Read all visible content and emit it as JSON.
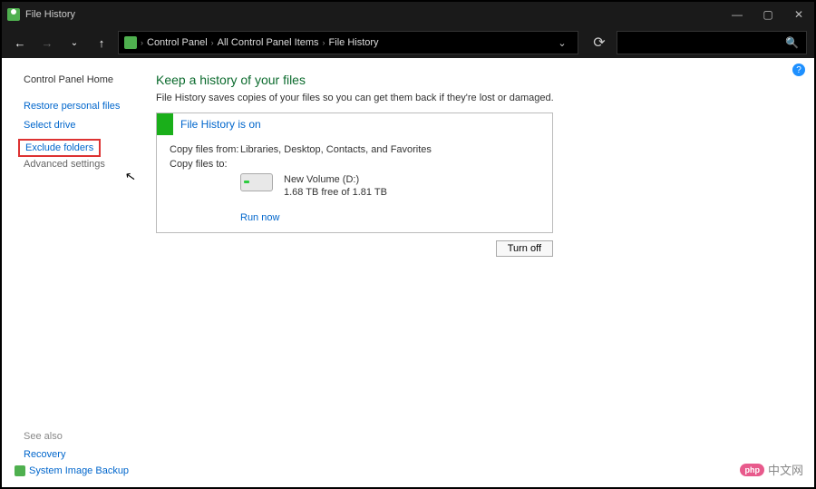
{
  "titlebar": {
    "title": "File History"
  },
  "breadcrumbs": {
    "b1": "Control Panel",
    "b2": "All Control Panel Items",
    "b3": "File History"
  },
  "sidebar": {
    "home": "Control Panel Home",
    "restore": "Restore personal files",
    "select_drive": "Select drive",
    "exclude_folders": "Exclude folders",
    "advanced": "Advanced settings",
    "see_also": "See also",
    "recovery": "Recovery",
    "sib": "System Image Backup"
  },
  "main": {
    "heading": "Keep a history of your files",
    "subtext": "File History saves copies of your files so you can get them back if they're lost or damaged.",
    "status_text": "File History is on",
    "copy_from_label": "Copy files from:",
    "copy_from_value": "Libraries, Desktop, Contacts, and Favorites",
    "copy_to_label": "Copy files to:",
    "drive_name": "New Volume (D:)",
    "drive_space": "1.68 TB free of 1.81 TB",
    "run_now": "Run now",
    "turn_off": "Turn off"
  },
  "watermark": {
    "pill": "php",
    "text": "中文网"
  }
}
